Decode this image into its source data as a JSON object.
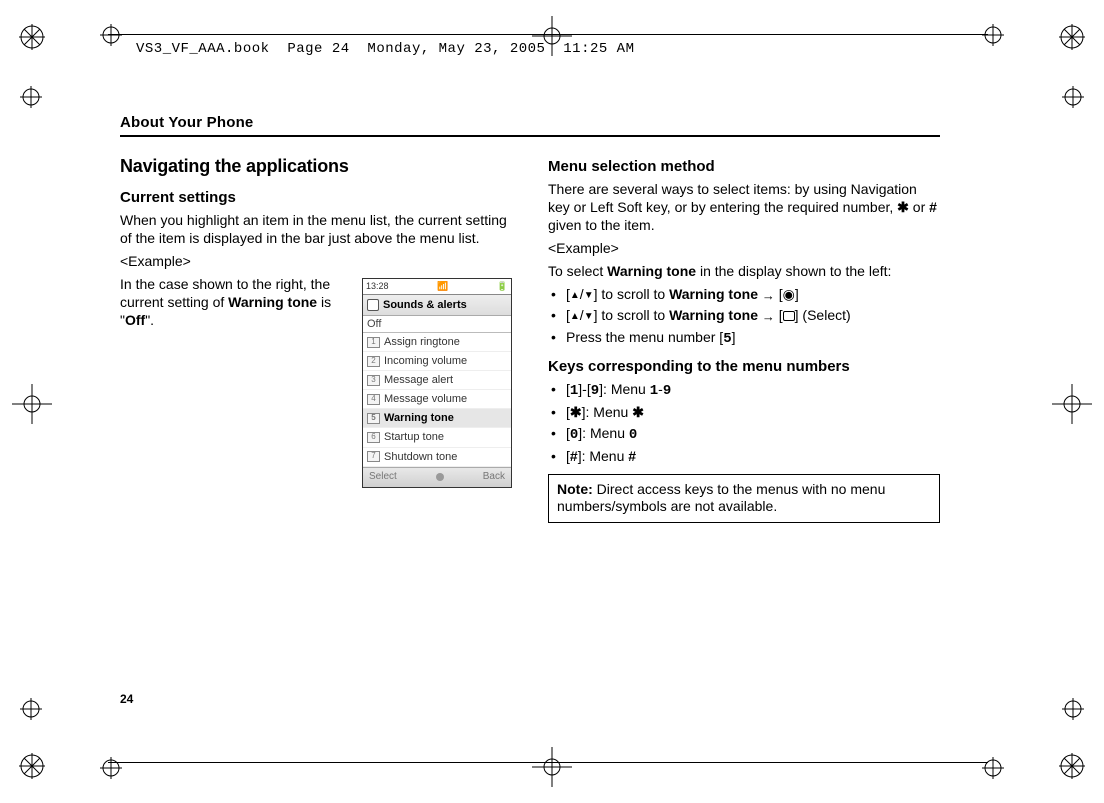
{
  "header": {
    "line": "VS3_VF_AAA.book  Page 24  Monday, May 23, 2005  11:25 AM"
  },
  "section_title": "About Your Phone",
  "page_number": "24",
  "left": {
    "h2": "Navigating the applications",
    "h3": "Current settings",
    "p1": "When you highlight an item in the menu list, the current setting of the item is displayed in the bar just above the menu list.",
    "p2": "<Example>",
    "p3a": "In the case shown to the right, the current setting of ",
    "p3b": "Warning tone",
    "p3c": " is \"",
    "p3d": "Off",
    "p3e": "\"."
  },
  "phone": {
    "time": "13:28",
    "title": "Sounds & alerts",
    "sub": "Off",
    "items": [
      "Assign ringtone",
      "Incoming volume",
      "Message alert",
      "Message volume",
      "Warning tone",
      "Startup tone",
      "Shutdown tone"
    ],
    "selected_index": 4,
    "soft_left": "Select",
    "soft_right": "Back"
  },
  "right": {
    "h3a": "Menu selection method",
    "p1a": "There are several ways to select items: by using Navigation key or Left Soft key, or by entering the required number, ",
    "p1b": " or ",
    "p1c": " given to the item.",
    "p2": "<Example>",
    "p3a": "To select ",
    "p3b": "Warning tone",
    "p3c": " in the display shown to the left:",
    "b1a": "] to scroll to ",
    "b1b": "Warning tone",
    "b2c": " (Select)",
    "b3a": "Press the menu number [",
    "b3b": "5",
    "h3b": "Keys corresponding to the menu numbers",
    "k1a": "1",
    "k1b": "9",
    "k1c": "]: Menu ",
    "k1d": "1",
    "k1e": "9",
    "k2a": "]: Menu ",
    "k3a": "0",
    "k3b": "]: Menu ",
    "k3c": "0",
    "k4a": "]: Menu ",
    "note_label": "Note:",
    "note_text": " Direct access keys to the menus with no menu numbers/symbols are not available."
  }
}
